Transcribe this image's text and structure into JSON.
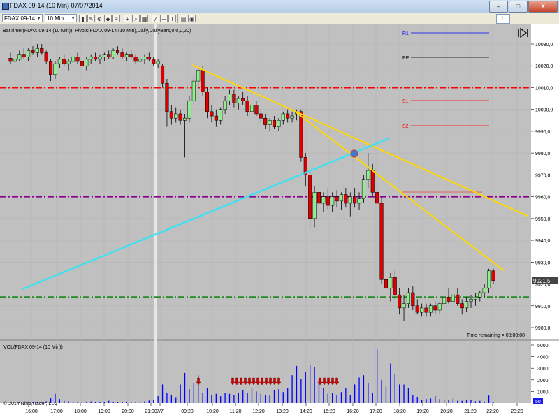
{
  "window": {
    "title": "FDAX 09-14 (10 Min)  07/07/2014",
    "minimize_label": "–",
    "maximize_label": "□",
    "close_label": "X"
  },
  "toolbar": {
    "instrument": "FDAX 09-14",
    "interval": "10 Min",
    "right_button": "L"
  },
  "chart_data": {
    "type": "candlestick",
    "indicator_label": "BarTimer(FDAX 09-14 (10 Min)), Pivots(FDAX 09-14 (10 Min),Daily,DailyBars,0,0,0,20)",
    "volume_label": "VOL(FDAX 09-14 (10 Min))",
    "copyright": "© 2014 NinjaTrader, LLC",
    "time_remaining": "Time remaining = 00:00:00",
    "current_price": "9921,5",
    "volume_flag": "50",
    "price_ticks": [
      {
        "value": 10030,
        "label": "10030,0"
      },
      {
        "value": 10020,
        "label": "10020,0"
      },
      {
        "value": 10010,
        "label": "10010,0"
      },
      {
        "value": 10000,
        "label": "10000,0"
      },
      {
        "value": 9990,
        "label": "9990,0"
      },
      {
        "value": 9980,
        "label": "9980,0"
      },
      {
        "value": 9970,
        "label": "9970,0"
      },
      {
        "value": 9960,
        "label": "9960,0"
      },
      {
        "value": 9950,
        "label": "9950,0"
      },
      {
        "value": 9940,
        "label": "9940,0"
      },
      {
        "value": 9930,
        "label": "9930,0"
      },
      {
        "value": 9920,
        "label": "9920,0"
      },
      {
        "value": 9910,
        "label": "9910,0"
      },
      {
        "value": 9900,
        "label": "9900,0"
      }
    ],
    "volume_ticks": [
      "5000",
      "4000",
      "3000",
      "2000",
      "1000"
    ],
    "time_ticks": [
      "16:00",
      "17:00",
      "18:00",
      "19:00",
      "20:00",
      "21:00",
      "7/7",
      "09:20",
      "10:20",
      "11:20",
      "12:20",
      "13:20",
      "14:20",
      "15:20",
      "16:20",
      "17:20",
      "18:20",
      "19:20",
      "20:20",
      "21:20",
      "22:20",
      "23:20"
    ],
    "pivot_labels": [
      "R1",
      "PP",
      "S1",
      "S2"
    ],
    "candles": [
      {
        "o": 10023.5,
        "h": 10026,
        "l": 10021,
        "c": 10022
      },
      {
        "o": 10022,
        "h": 10024,
        "l": 10020,
        "c": 10023
      },
      {
        "o": 10023,
        "h": 10027,
        "l": 10022,
        "c": 10025
      },
      {
        "o": 10025,
        "h": 10028,
        "l": 10023,
        "c": 10024
      },
      {
        "o": 10024,
        "h": 10028,
        "l": 10022,
        "c": 10027
      },
      {
        "o": 10027,
        "h": 10029,
        "l": 10025,
        "c": 10026
      },
      {
        "o": 10026,
        "h": 10030,
        "l": 10024,
        "c": 10028
      },
      {
        "o": 10028,
        "h": 10030,
        "l": 10025,
        "c": 10026
      },
      {
        "o": 10026,
        "h": 10027,
        "l": 10021,
        "c": 10022
      },
      {
        "o": 10022,
        "h": 10023,
        "l": 10013,
        "c": 10016
      },
      {
        "o": 10016,
        "h": 10022,
        "l": 10014,
        "c": 10021
      },
      {
        "o": 10021,
        "h": 10024,
        "l": 10019,
        "c": 10023
      },
      {
        "o": 10023,
        "h": 10025,
        "l": 10020,
        "c": 10021
      },
      {
        "o": 10021,
        "h": 10023,
        "l": 10018,
        "c": 10022
      },
      {
        "o": 10022,
        "h": 10025,
        "l": 10020,
        "c": 10024
      },
      {
        "o": 10024,
        "h": 10026,
        "l": 10021,
        "c": 10022
      },
      {
        "o": 10022,
        "h": 10023,
        "l": 10018,
        "c": 10020
      },
      {
        "o": 10020,
        "h": 10024,
        "l": 10018,
        "c": 10023
      },
      {
        "o": 10023,
        "h": 10025,
        "l": 10021,
        "c": 10024
      },
      {
        "o": 10024,
        "h": 10026,
        "l": 10022,
        "c": 10023
      },
      {
        "o": 10023,
        "h": 10025,
        "l": 10021,
        "c": 10024
      },
      {
        "o": 10024,
        "h": 10026,
        "l": 10022,
        "c": 10025
      },
      {
        "o": 10025,
        "h": 10027,
        "l": 10023,
        "c": 10024
      },
      {
        "o": 10024,
        "h": 10028,
        "l": 10023,
        "c": 10027
      },
      {
        "o": 10027,
        "h": 10029,
        "l": 10025,
        "c": 10026
      },
      {
        "o": 10026,
        "h": 10028,
        "l": 10023,
        "c": 10024
      },
      {
        "o": 10024,
        "h": 10026,
        "l": 10022,
        "c": 10025
      },
      {
        "o": 10025,
        "h": 10027,
        "l": 10023,
        "c": 10024
      },
      {
        "o": 10024,
        "h": 10025,
        "l": 10021,
        "c": 10022
      },
      {
        "o": 10022,
        "h": 10024,
        "l": 10020,
        "c": 10023
      },
      {
        "o": 10023,
        "h": 10025,
        "l": 10021,
        "c": 10024
      },
      {
        "o": 10024,
        "h": 10026,
        "l": 10022,
        "c": 10023
      },
      {
        "o": 10023,
        "h": 10024,
        "l": 10020,
        "c": 10021
      },
      {
        "o": 10021,
        "h": 10023,
        "l": 10019,
        "c": 10022
      },
      {
        "o": 10020,
        "h": 10021,
        "l": 10010,
        "c": 10012
      },
      {
        "o": 10012,
        "h": 10014,
        "l": 9992,
        "c": 9999
      },
      {
        "o": 9999,
        "h": 10002,
        "l": 9993,
        "c": 9996
      },
      {
        "o": 9996,
        "h": 10001,
        "l": 9994,
        "c": 9998
      },
      {
        "o": 9998,
        "h": 10000,
        "l": 9993,
        "c": 9995
      },
      {
        "o": 9995,
        "h": 9998,
        "l": 9978,
        "c": 9996
      },
      {
        "o": 9996,
        "h": 10006,
        "l": 9994,
        "c": 10004
      },
      {
        "o": 10004,
        "h": 10015,
        "l": 10002,
        "c": 10013
      },
      {
        "o": 10013,
        "h": 10020,
        "l": 10010,
        "c": 10018
      },
      {
        "o": 10018,
        "h": 10020,
        "l": 10006,
        "c": 10008
      },
      {
        "o": 10008,
        "h": 10010,
        "l": 9996,
        "c": 9999
      },
      {
        "o": 9999,
        "h": 10002,
        "l": 9994,
        "c": 9997
      },
      {
        "o": 9997,
        "h": 10000,
        "l": 9992,
        "c": 9995
      },
      {
        "o": 9995,
        "h": 10001,
        "l": 9993,
        "c": 10000
      },
      {
        "o": 10000,
        "h": 10006,
        "l": 9998,
        "c": 10004
      },
      {
        "o": 10004,
        "h": 10009,
        "l": 10002,
        "c": 10007
      },
      {
        "o": 10007,
        "h": 10009,
        "l": 10001,
        "c": 10003
      },
      {
        "o": 10003,
        "h": 10006,
        "l": 10000,
        "c": 10005
      },
      {
        "o": 10005,
        "h": 10008,
        "l": 10002,
        "c": 10004
      },
      {
        "o": 10004,
        "h": 10006,
        "l": 9997,
        "c": 9999
      },
      {
        "o": 9999,
        "h": 10003,
        "l": 9996,
        "c": 10002
      },
      {
        "o": 10002,
        "h": 10004,
        "l": 9997,
        "c": 9998
      },
      {
        "o": 9998,
        "h": 10000,
        "l": 9994,
        "c": 9996
      },
      {
        "o": 9996,
        "h": 9998,
        "l": 9991,
        "c": 9993
      },
      {
        "o": 9993,
        "h": 9996,
        "l": 9990,
        "c": 9995
      },
      {
        "o": 9995,
        "h": 9997,
        "l": 9991,
        "c": 9992
      },
      {
        "o": 9992,
        "h": 9996,
        "l": 9990,
        "c": 9995
      },
      {
        "o": 9995,
        "h": 9999,
        "l": 9993,
        "c": 9998
      },
      {
        "o": 9998,
        "h": 10000,
        "l": 9994,
        "c": 9996
      },
      {
        "o": 9996,
        "h": 9999,
        "l": 9994,
        "c": 9997
      },
      {
        "o": 9998,
        "h": 10000,
        "l": 9995,
        "c": 9999
      },
      {
        "o": 9999,
        "h": 10000,
        "l": 9976,
        "c": 9978
      },
      {
        "o": 9978,
        "h": 9980,
        "l": 9965,
        "c": 9970
      },
      {
        "o": 9970,
        "h": 9972,
        "l": 9945,
        "c": 9950
      },
      {
        "o": 9950,
        "h": 9965,
        "l": 9946,
        "c": 9962
      },
      {
        "o": 9962,
        "h": 9965,
        "l": 9954,
        "c": 9957
      },
      {
        "o": 9957,
        "h": 9962,
        "l": 9953,
        "c": 9960
      },
      {
        "o": 9960,
        "h": 9964,
        "l": 9954,
        "c": 9956
      },
      {
        "o": 9956,
        "h": 9962,
        "l": 9953,
        "c": 9960
      },
      {
        "o": 9960,
        "h": 9963,
        "l": 9955,
        "c": 9958
      },
      {
        "o": 9958,
        "h": 9962,
        "l": 9954,
        "c": 9961
      },
      {
        "o": 9961,
        "h": 9964,
        "l": 9955,
        "c": 9957
      },
      {
        "o": 9957,
        "h": 9962,
        "l": 9951,
        "c": 9960
      },
      {
        "o": 9960,
        "h": 9964,
        "l": 9955,
        "c": 9957
      },
      {
        "o": 9957,
        "h": 9962,
        "l": 9954,
        "c": 9959
      },
      {
        "o": 9959,
        "h": 9970,
        "l": 9957,
        "c": 9968
      },
      {
        "o": 9968,
        "h": 9980,
        "l": 9964,
        "c": 9972
      },
      {
        "o": 9972,
        "h": 9975,
        "l": 9960,
        "c": 9962
      },
      {
        "o": 9962,
        "h": 9965,
        "l": 9955,
        "c": 9957
      },
      {
        "o": 9957,
        "h": 9960,
        "l": 9920,
        "c": 9922
      },
      {
        "o": 9922,
        "h": 9927,
        "l": 9905,
        "c": 9918
      },
      {
        "o": 9918,
        "h": 9925,
        "l": 9912,
        "c": 9923
      },
      {
        "o": 9923,
        "h": 9926,
        "l": 9913,
        "c": 9915
      },
      {
        "o": 9915,
        "h": 9918,
        "l": 9906,
        "c": 9909
      },
      {
        "o": 9909,
        "h": 9915,
        "l": 9903,
        "c": 9911
      },
      {
        "o": 9911,
        "h": 9918,
        "l": 9909,
        "c": 9916
      },
      {
        "o": 9916,
        "h": 9919,
        "l": 9908,
        "c": 9910
      },
      {
        "o": 9910,
        "h": 9913,
        "l": 9906,
        "c": 9907
      },
      {
        "o": 9907,
        "h": 9911,
        "l": 9905,
        "c": 9909
      },
      {
        "o": 9909,
        "h": 9911,
        "l": 9905,
        "c": 9907
      },
      {
        "o": 9907,
        "h": 9911,
        "l": 9905,
        "c": 9910
      },
      {
        "o": 9910,
        "h": 9912,
        "l": 9906,
        "c": 9908
      },
      {
        "o": 9908,
        "h": 9912,
        "l": 9906,
        "c": 9911
      },
      {
        "o": 9911,
        "h": 9916,
        "l": 9909,
        "c": 9914
      },
      {
        "o": 9914,
        "h": 9918,
        "l": 9911,
        "c": 9912
      },
      {
        "o": 9912,
        "h": 9916,
        "l": 9910,
        "c": 9915
      },
      {
        "o": 9915,
        "h": 9918,
        "l": 9910,
        "c": 9911
      },
      {
        "o": 9911,
        "h": 9913,
        "l": 9906,
        "c": 9909
      },
      {
        "o": 9909,
        "h": 9914,
        "l": 9907,
        "c": 9912
      },
      {
        "o": 9912,
        "h": 9915,
        "l": 9909,
        "c": 9913
      },
      {
        "o": 9913,
        "h": 9916,
        "l": 9910,
        "c": 9914
      },
      {
        "o": 9914,
        "h": 9917,
        "l": 9912,
        "c": 9916
      },
      {
        "o": 9916,
        "h": 9920,
        "l": 9914,
        "c": 9918
      },
      {
        "o": 9918,
        "h": 9927,
        "l": 9916,
        "c": 9926
      },
      {
        "o": 9926,
        "h": 9927,
        "l": 9920,
        "c": 9921.5
      }
    ],
    "volumes": [
      40,
      30,
      60,
      20,
      30,
      80,
      40,
      30,
      150,
      420,
      800,
      350,
      200,
      150,
      100,
      120,
      80,
      70,
      150,
      100,
      80,
      90,
      200,
      100,
      120,
      60,
      90,
      100,
      70,
      80,
      150,
      220,
      300,
      600,
      1600,
      900,
      700,
      450,
      1600,
      2600,
      1200,
      1700,
      2400,
      900,
      1300,
      700,
      800,
      600,
      900,
      800,
      700,
      850,
      1100,
      900,
      1300,
      1000,
      800,
      700,
      650,
      1100,
      1200,
      950,
      1300,
      2400,
      3200,
      2100,
      2700,
      3300,
      3100,
      2000,
      1300,
      800,
      900,
      700,
      950,
      1300,
      700,
      1600,
      2200,
      2400,
      1700,
      900,
      4700,
      2000,
      1400,
      3400,
      2500,
      1600,
      1600,
      1300,
      700,
      500,
      300,
      350,
      400,
      600,
      350,
      300,
      250,
      400,
      200,
      200,
      250,
      300,
      150,
      200,
      100,
      650,
      80
    ]
  },
  "colors": {
    "chart_bg": "#c0c0c0",
    "up_candle": "#90ee90",
    "down_candle": "#dd0000",
    "volume_bar": "#0000ff",
    "r1_line": "#0000ff",
    "pp_line": "#000000",
    "s_line": "#ff0000",
    "red_level": "#ff0000",
    "purple_level": "#8b008b",
    "green_level": "#228b22",
    "trend_yellow": "#ffd700",
    "trend_cyan": "#40e0f0",
    "arrow_color": "#cc0000"
  }
}
